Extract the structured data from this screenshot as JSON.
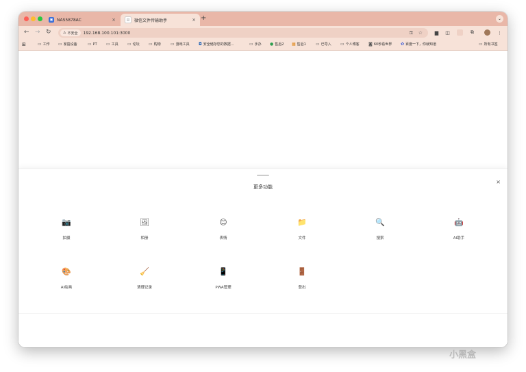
{
  "browser": {
    "tabs": [
      {
        "title": "NAS5878AC",
        "close_glyph": "×",
        "favicon": "nas-favicon-icon"
      },
      {
        "title": "微信文件传输助手",
        "close_glyph": "×",
        "favicon": "page-favicon-icon"
      }
    ],
    "new_tab_glyph": "+",
    "tab_menu_glyph": "⌄",
    "nav": {
      "back": "←",
      "forward": "→",
      "reload": "↻"
    },
    "omnibox": {
      "security_label": "不安全",
      "security_glyph": "⚠",
      "url": "192.168.100.101:3000",
      "key_glyph": "⚿",
      "star_glyph": "☆"
    },
    "menu_glyph": "⋮",
    "bookmarks": {
      "apps_glyph": "⊞",
      "folder_glyph": "▭",
      "items": [
        "工作",
        "家庭设备",
        "PT",
        "工具",
        "论坛",
        "购物",
        "游戏工具",
        "安全储存您的数据...",
        "手办",
        "售后2",
        "售后1",
        "已导入",
        "个人博客",
        "60秒看世界",
        "百度一下，你就知道"
      ],
      "all_bookmarks": "所有书签"
    }
  },
  "sheet": {
    "title": "更多功能",
    "close_glyph": "×",
    "items": [
      {
        "label": "拍摄",
        "glyph": "📷",
        "icon": "camera-icon"
      },
      {
        "label": "相册",
        "glyph": "🖼",
        "icon": "photo-album-icon"
      },
      {
        "label": "表情",
        "glyph": "😊",
        "icon": "emoji-icon"
      },
      {
        "label": "文件",
        "glyph": "📁",
        "icon": "file-folder-icon"
      },
      {
        "label": "搜索",
        "glyph": "🔍",
        "icon": "search-icon"
      },
      {
        "label": "AI助手",
        "glyph": "🤖",
        "icon": "ai-assistant-icon"
      },
      {
        "label": "AI绘画",
        "glyph": "🎨",
        "icon": "palette-icon"
      },
      {
        "label": "清理记录",
        "glyph": "🧹",
        "icon": "broom-icon"
      },
      {
        "label": "PWA管理",
        "glyph": "📱",
        "icon": "phone-icon"
      },
      {
        "label": "登出",
        "glyph": "🚪",
        "icon": "door-icon"
      }
    ]
  },
  "watermark": "小黑盒"
}
